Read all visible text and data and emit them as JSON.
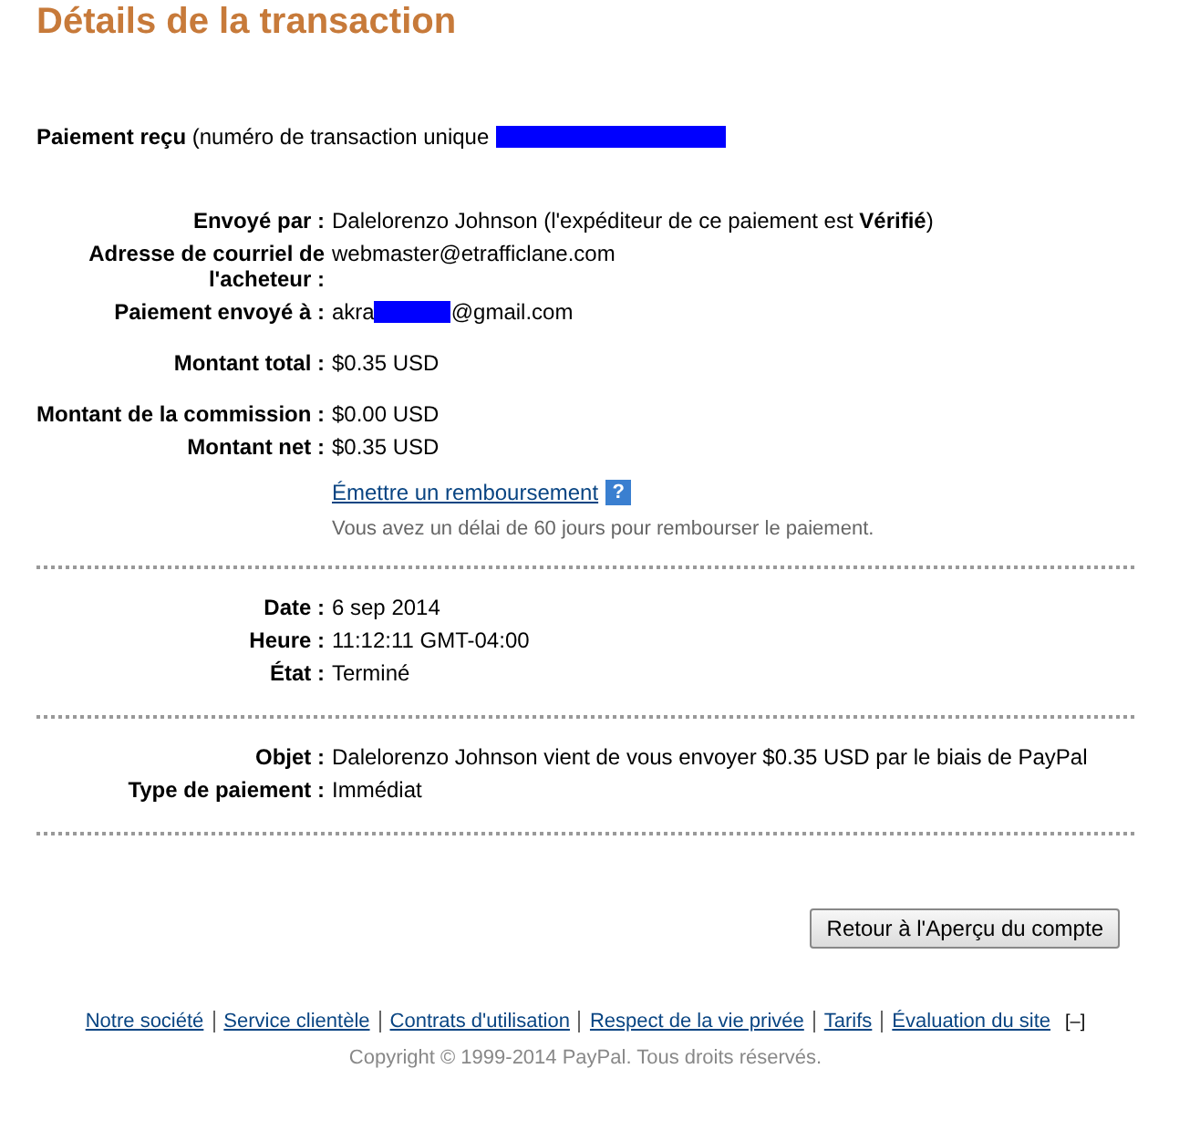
{
  "title": "Détails de la transaction",
  "header": {
    "label": "Paiement reçu",
    "parts": [
      {
        "kind": "text",
        "text": "(numéro de transaction unique"
      },
      {
        "kind": "redaction"
      }
    ]
  },
  "sections": [
    {
      "groups": [
        {
          "rows": [
            {
              "label": "Envoyé par :",
              "parts": [
                {
                  "kind": "text",
                  "text": "Dalelorenzo Johnson (l'expéditeur de ce paiement est **Vérifié**)"
                }
              ]
            },
            {
              "label": "Adresse de courriel de l'acheteur :",
              "parts": [
                {
                  "kind": "text",
                  "text": "webmaster@etrafficlane.com"
                }
              ]
            },
            {
              "label": "Paiement envoyé à :",
              "parts": [
                {
                  "kind": "text",
                  "text": "akra"
                },
                {
                  "kind": "redaction"
                },
                {
                  "kind": "text",
                  "text": "@gmail.com"
                }
              ]
            }
          ]
        },
        {
          "rows": [
            {
              "label": "Montant total :",
              "parts": [
                {
                  "kind": "text",
                  "text": "$0.35 USD"
                }
              ]
            }
          ]
        },
        {
          "rows": [
            {
              "label": "Montant de la commission :",
              "parts": [
                {
                  "kind": "text",
                  "text": "$0.00 USD"
                }
              ]
            },
            {
              "label": "Montant net :",
              "parts": [
                {
                  "kind": "text",
                  "text": "$0.35 USD"
                }
              ]
            }
          ]
        }
      ],
      "refund": {
        "link": "Émettre un remboursement",
        "help": "?",
        "note": "Vous avez un délai de 60 jours pour rembourser le paiement."
      }
    },
    {
      "groups": [
        {
          "rows": [
            {
              "label": "Date :",
              "parts": [
                {
                  "kind": "text",
                  "text": "6 sep 2014"
                }
              ]
            },
            {
              "label": "Heure :",
              "parts": [
                {
                  "kind": "text",
                  "text": "11:12:11 GMT-04:00"
                }
              ]
            },
            {
              "label": "État :",
              "parts": [
                {
                  "kind": "text",
                  "text": "Terminé"
                }
              ]
            }
          ]
        }
      ]
    },
    {
      "groups": [
        {
          "rows": [
            {
              "label": "Objet :",
              "parts": [
                {
                  "kind": "text",
                  "text": "Dalelorenzo Johnson vient de vous envoyer $0.35 USD par le biais de PayPal"
                }
              ]
            },
            {
              "label": "Type de paiement :",
              "parts": [
                {
                  "kind": "text",
                  "text": "Immédiat"
                }
              ]
            }
          ]
        }
      ]
    }
  ],
  "button": "Retour à l'Aperçu du compte",
  "footer": {
    "links": [
      "Notre société",
      "Service clientèle",
      "Contrats d'utilisation",
      "Respect de la vie privée",
      "Tarifs",
      "Évaluation du site"
    ],
    "toggle": "[–]",
    "copyright": "Copyright © 1999-2014 PayPal. Tous droits réservés."
  }
}
